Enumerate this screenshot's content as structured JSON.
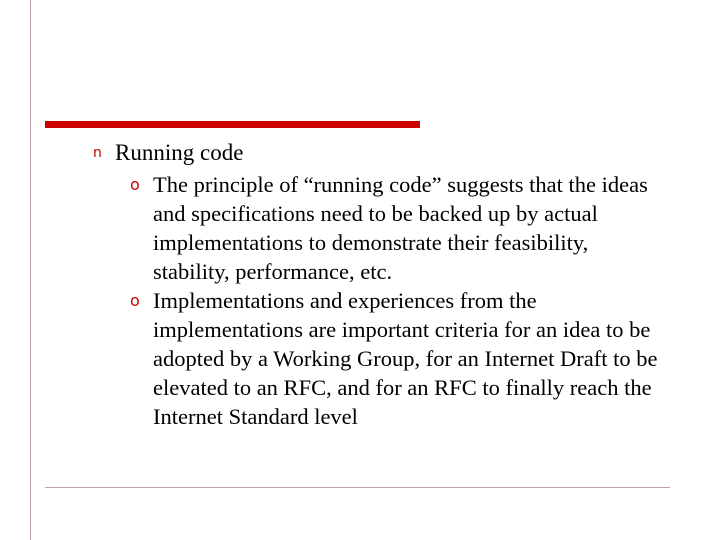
{
  "slide": {
    "accent_color": "#cc0000",
    "rule_color": "#c9a0a0",
    "background_color": "#ffffff",
    "text_color": "#000000",
    "bullets": [
      {
        "level": 1,
        "marker": "n",
        "text": "Running code"
      },
      {
        "level": 2,
        "marker": "o",
        "text": "The principle of “running code” suggests that the ideas and specifications need to be backed up by actual implementations to demonstrate their feasibility, stability, performance, etc."
      },
      {
        "level": 2,
        "marker": "o",
        "text": "Implementations and experiences from the implementations are important criteria for an idea to be adopted by a Working Group, for an Internet Draft to be elevated to an RFC, and for an RFC to finally reach the Internet Standard level"
      }
    ]
  }
}
